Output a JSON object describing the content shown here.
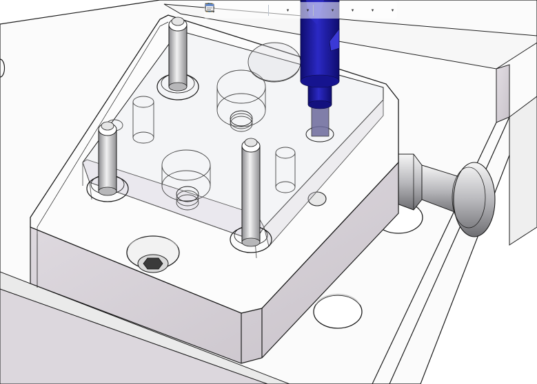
{
  "viewport": {
    "background": "#ffffff",
    "model_colors": {
      "plate_face": "#fbfbfb",
      "plate_side": "#d7d2d8",
      "edge": "#1a1a1a",
      "tool_holder": "#1c1aa6",
      "tool_holder_dark": "#0e0c6e",
      "steel": "#c9c9cc"
    }
  },
  "hud_toolbar": {
    "buttons": [
      {
        "icon": "zoom-to-fit-icon"
      },
      {
        "icon": "zoom-to-area-icon"
      },
      {
        "icon": "previous-view-icon"
      },
      {
        "icon": "section-view-icon"
      },
      {
        "icon": "view-orientation-icon",
        "dropdown": true
      },
      {
        "icon": "display-style-icon",
        "dropdown": true
      },
      {
        "icon": "hide-show-items-icon",
        "dropdown": true
      },
      {
        "icon": "edit-appearance-icon",
        "dropdown": true
      },
      {
        "icon": "apply-scene-icon",
        "dropdown": true
      },
      {
        "icon": "view-settings-icon",
        "dropdown": true
      }
    ]
  }
}
